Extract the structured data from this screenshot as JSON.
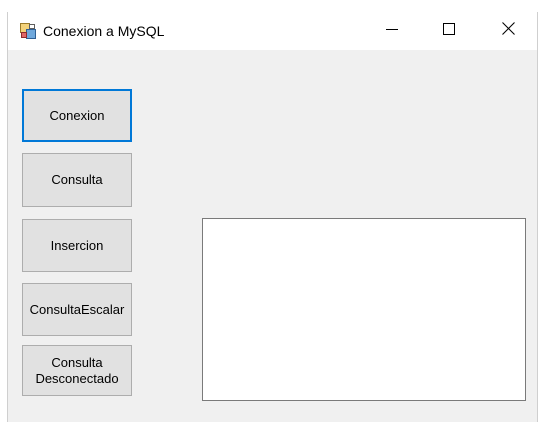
{
  "window": {
    "title": "Conexion a MySQL"
  },
  "title_controls": {
    "minimize_icon": "minimize-icon",
    "maximize_icon": "maximize-icon",
    "close_icon": "close-icon"
  },
  "buttons": {
    "conexion": "Conexion",
    "consulta": "Consulta",
    "insercion": "Insercion",
    "consulta_escalar": "ConsultaEscalar",
    "consulta_desconectado": "Consulta\nDesconectado"
  },
  "output": {
    "value": ""
  },
  "colors": {
    "focus_border": "#0078d7",
    "button_face": "#e1e1e1",
    "form_background": "#f0f0f0"
  }
}
